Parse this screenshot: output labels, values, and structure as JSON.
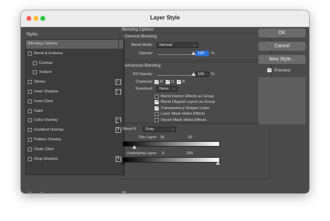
{
  "window": {
    "title": "Layer Style"
  },
  "styles_panel": {
    "header": "Styles",
    "items": [
      {
        "label": "Blending Options",
        "checkbox": false,
        "plus": false,
        "selected": true,
        "indent": 0
      },
      {
        "label": "Bevel & Emboss",
        "checkbox": true,
        "plus": false,
        "selected": false,
        "indent": 0
      },
      {
        "label": "Contour",
        "checkbox": true,
        "plus": false,
        "selected": false,
        "indent": 1
      },
      {
        "label": "Texture",
        "checkbox": true,
        "plus": false,
        "selected": false,
        "indent": 1
      },
      {
        "label": "Stroke",
        "checkbox": true,
        "plus": true,
        "selected": false,
        "indent": 0
      },
      {
        "label": "Inner Shadow",
        "checkbox": true,
        "plus": true,
        "selected": false,
        "indent": 0
      },
      {
        "label": "Inner Glow",
        "checkbox": true,
        "plus": false,
        "selected": false,
        "indent": 0
      },
      {
        "label": "Satin",
        "checkbox": true,
        "plus": false,
        "selected": false,
        "indent": 0
      },
      {
        "label": "Color Overlay",
        "checkbox": true,
        "plus": true,
        "selected": false,
        "indent": 0
      },
      {
        "label": "Gradient Overlay",
        "checkbox": true,
        "plus": true,
        "selected": false,
        "indent": 0
      },
      {
        "label": "Pattern Overlay",
        "checkbox": true,
        "plus": false,
        "selected": false,
        "indent": 0
      },
      {
        "label": "Outer Glow",
        "checkbox": true,
        "plus": false,
        "selected": false,
        "indent": 0
      },
      {
        "label": "Drop Shadow",
        "checkbox": true,
        "plus": true,
        "selected": false,
        "indent": 0
      }
    ],
    "bottom_icons": [
      "fx-icon",
      "move-up-icon",
      "move-down-icon",
      "trash-icon"
    ],
    "fx_label": "fx"
  },
  "blending": {
    "title": "Blending Options",
    "general": {
      "title": "General Blending",
      "blend_mode_label": "Blend Mode:",
      "blend_mode_value": "Normal",
      "opacity_label": "Opacity:",
      "opacity_value": "100",
      "opacity_unit": "%"
    },
    "advanced": {
      "title": "Advanced Blending",
      "fill_opacity_label": "Fill Opacity:",
      "fill_opacity_value": "100",
      "fill_opacity_unit": "%",
      "channels_label": "Channels:",
      "channels": [
        "R",
        "G",
        "B"
      ],
      "knockout_label": "Knockout:",
      "knockout_value": "None",
      "options": [
        {
          "label": "Blend Interior Effects as Group",
          "checked": false
        },
        {
          "label": "Blend Clipped Layers as Group",
          "checked": true
        },
        {
          "label": "Transparency Shapes Layer",
          "checked": true
        },
        {
          "label": "Layer Mask Hides Effects",
          "checked": false
        },
        {
          "label": "Vector Mask Hides Effects",
          "checked": false
        }
      ]
    },
    "blend_if": {
      "label": "Blend If:",
      "value": "Gray",
      "this_layer_label": "This Layer:",
      "this_layer_low": "30",
      "this_layer_high": "30",
      "underlying_label": "Underlying Layer:",
      "underlying_low": "0",
      "underlying_high": "255"
    }
  },
  "buttons": {
    "ok": "OK",
    "cancel": "Cancel",
    "new_style": "New Style...",
    "preview_label": "Preview",
    "preview_checked": true
  },
  "colors": {
    "dialog_bg": "#4a4a4a",
    "selected_row": "#5f5f5f",
    "accent_blue": "#2c6fd8"
  }
}
